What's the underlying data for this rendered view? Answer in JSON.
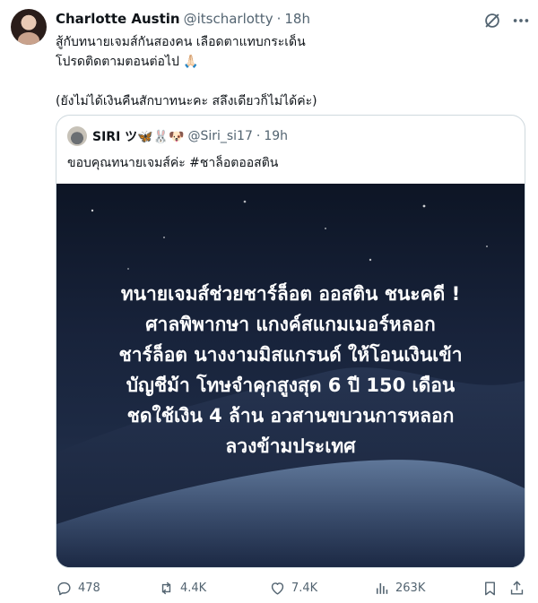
{
  "tweet": {
    "author": {
      "display_name": "Charlotte Austin",
      "handle": "@itscharlotty",
      "time": "18h"
    },
    "text_lines": [
      "สู้กับทนายเจมส์กันสองคน เลือดตาแทบกระเด็น",
      "โปรดติดตามตอนต่อไป 🙏🏻"
    ],
    "text_note": "(ยังไม่ได้เงินคืนสักบาทนะคะ สลึงเดียวก็ไม่ได้ค่ะ)"
  },
  "quoted_tweet": {
    "display_name": "SIRI ツ🦋🐰🐶",
    "handle": "@Siri_si17",
    "time": "19h",
    "text": "ขอบคุณทนายเจมส์ค่ะ #ชาล็อตออสติน",
    "image_text_lines": [
      "ทนายเจมส์ช่วยชาร์ล็อต ออสติน ชนะคดี !",
      "ศาลพิพากษา แกงค์สแกมเมอร์หลอก",
      "ชาร์ล็อต นางงามมิสแกรนด์ ให้โอนเงินเข้า",
      "บัญชีม้า โทษจำคุกสูงสุด 6 ปี 150 เดือน",
      "ชดใช้เงิน 4 ล้าน อวสานขบวนการหลอก",
      "ลวงข้ามประเทศ"
    ]
  },
  "actions": {
    "replies": "478",
    "reposts": "4.4K",
    "likes": "7.4K",
    "views": "263K"
  },
  "icons": [
    "grok-icon",
    "more-icon",
    "reply-icon",
    "repost-icon",
    "like-icon",
    "views-icon",
    "bookmark-icon",
    "share-icon"
  ],
  "colors": {
    "text_primary": "#0f1419",
    "text_secondary": "#536471",
    "border": "#cfd9de",
    "media_background": "#1d2a44"
  }
}
